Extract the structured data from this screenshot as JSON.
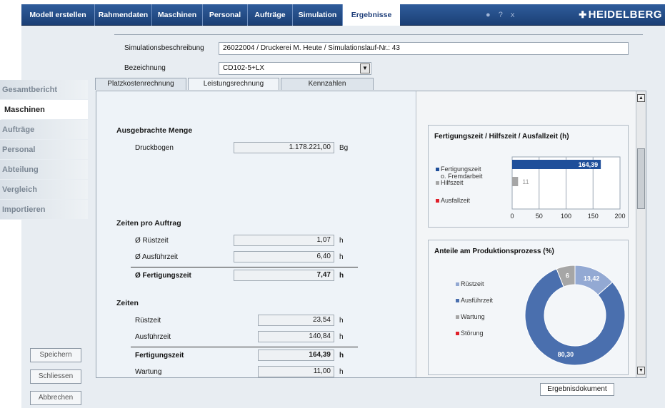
{
  "nav": {
    "tabs": [
      "Modell erstellen",
      "Rahmendaten",
      "Maschinen",
      "Personal",
      "Aufträge",
      "Simulation",
      "Ergebnisse"
    ],
    "active_tab": "Ergebnisse",
    "icon_names": [
      "lock-icon",
      "help-icon",
      "close-icon"
    ],
    "icons": [
      "●",
      "?",
      "x"
    ],
    "logo": "HEIDELBERG"
  },
  "header": {
    "sim_label": "Simulationsbeschreibung",
    "sim_value": "26022004 / Druckerei M. Heute / Simulationslauf-Nr.: 43",
    "bez_label": "Bezeichnung",
    "bez_value": "CD102-5+LX"
  },
  "sidebar": {
    "items": [
      "Gesamtbericht",
      "Maschinen",
      "Aufträge",
      "Personal",
      "Abteilung",
      "Vergleich",
      "Importieren"
    ],
    "active": "Maschinen",
    "buttons": [
      "Speichern",
      "Schliessen",
      "Abbrechen"
    ]
  },
  "subtabs": [
    "Platzkostenrechnung",
    "Leistungsrechnung",
    "Kennzahlen"
  ],
  "active_subtab": "Leistungsrechnung",
  "left": {
    "sec1_title": "Ausgebrachte Menge",
    "druckbogen_label": "Druckbogen",
    "druckbogen_value": "1.178.221,00",
    "druckbogen_unit": "Bg",
    "sec2_title": "Zeiten pro Auftrag",
    "ruestzeit_label": "Ø Rüstzeit",
    "ruestzeit_value": "1,07",
    "ausfuehr_label": "Ø Ausführzeit",
    "ausfuehr_value": "6,40",
    "fert_label": "Ø Fertigungszeit",
    "fert_value": "7,47",
    "unit_h": "h",
    "sec3_title": "Zeiten",
    "z_ruest_label": "Rüstzeit",
    "z_ruest_value": "23,54",
    "z_ausf_label": "Ausführzeit",
    "z_ausf_value": "140,84",
    "z_fert_label": "Fertigungszeit",
    "z_fert_value": "164,39",
    "z_wart_label": "Wartung",
    "z_wart_value": "11,00"
  },
  "result_button": "Ergebnisdokument",
  "chart_data": [
    {
      "type": "bar",
      "orientation": "horizontal",
      "title": "Fertigungszeit / Hilfszeit / Ausfallzeit (h)",
      "legend": [
        "Fertigungszeit o. Fremdarbeit",
        "Hilfszeit",
        "Ausfallzeit"
      ],
      "legend_line1": "Fertigungszeit",
      "legend_line2": "o. Fremdarbeit",
      "categories": [
        "Fertigungszeit o. Fremdarbeit",
        "Hilfszeit",
        "Ausfallzeit"
      ],
      "values": [
        164.39,
        11,
        0
      ],
      "value_labels": [
        "164,39",
        "11",
        ""
      ],
      "colors": [
        "#1f4f9a",
        "#a6a6a6",
        "#e0202a"
      ],
      "xlim": [
        0,
        200
      ],
      "xticks": [
        "0",
        "50",
        "100",
        "150",
        "200"
      ],
      "grid": true
    },
    {
      "type": "pie",
      "donut": true,
      "title": "Anteile am Produktionsprozess (%)",
      "legend": [
        "Rüstzeit",
        "Ausführzeit",
        "Wartung",
        "Störung"
      ],
      "values": [
        13.42,
        80.3,
        6,
        0
      ],
      "value_labels": [
        "13,42",
        "80,30",
        "6",
        ""
      ],
      "colors": [
        "#93a9d3",
        "#4a6fae",
        "#a6a6a6",
        "#e0202a"
      ]
    }
  ]
}
